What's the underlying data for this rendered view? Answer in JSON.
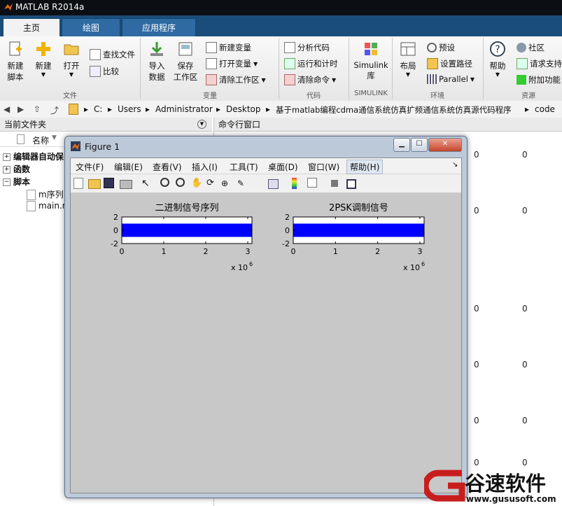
{
  "window": {
    "title": "MATLAB R2014a"
  },
  "tabs": [
    {
      "label": "主页"
    },
    {
      "label": "绘图"
    },
    {
      "label": "应用程序"
    }
  ],
  "ribbon": {
    "file": {
      "new_script": "新建\n脚本",
      "new": "新建",
      "open": "打开",
      "find_files": "查找文件",
      "compare": "比较",
      "group": "文件"
    },
    "variable": {
      "import": "导入\n数据",
      "save_workspace": "保存\n工作区",
      "new_variable": "新建变量",
      "open_variable": "打开变量",
      "clear_workspace": "清除工作区",
      "group": "变量"
    },
    "code": {
      "analyze": "分析代码",
      "run_time": "运行和计时",
      "clear_commands": "清除命令",
      "group": "代码"
    },
    "simulink": {
      "label": "Simulink\n库",
      "group": "SIMULINK"
    },
    "environment": {
      "layout": "布局",
      "preferences": "预设",
      "set_path": "设置路径",
      "parallel": "Parallel",
      "group": "环境"
    },
    "resources": {
      "help": "帮助",
      "community": "社区",
      "request_support": "请求支持",
      "addons": "附加功能",
      "group": "资源"
    }
  },
  "address_bar": {
    "path": [
      "C:",
      "Users",
      "Administrator",
      "Desktop",
      "基于matlab编程cdma通信系统仿真扩频通信系统仿真源代码程序",
      "code"
    ]
  },
  "current_folder": {
    "title": "当前文件夹",
    "column_name": "名称",
    "sort": "▼",
    "items": [
      {
        "label": "编辑器自动保"
      },
      {
        "label": "函数"
      },
      {
        "label": "脚本"
      },
      {
        "label": "m序列"
      },
      {
        "label": "main.m"
      }
    ]
  },
  "command_window": {
    "title": "命令行窗口",
    "values": [
      "0",
      "0",
      "0",
      "0",
      "0",
      "0",
      "0",
      "0",
      "0",
      "0",
      "0",
      "0"
    ]
  },
  "figure": {
    "title": "Figure 1",
    "menu": [
      "文件(F)",
      "编辑(E)",
      "查看(V)",
      "插入(I)",
      "工具(T)",
      "桌面(D)",
      "窗口(W)",
      "帮助(H)"
    ],
    "toolbar_icons": [
      "new-figure-icon",
      "open-icon",
      "save-icon",
      "print-icon",
      "pointer-icon",
      "zoom-in-icon",
      "zoom-out-icon",
      "pan-icon",
      "rotate-icon",
      "data-cursor-icon",
      "brush-icon",
      "link-icon",
      "colorbar-icon",
      "legend-icon",
      "hide-plot-tools-icon",
      "show-plot-tools-icon"
    ],
    "bar_color": "#0000ff"
  },
  "chart_data": [
    {
      "type": "area",
      "title": "二进制信号序列",
      "xlim": [
        0,
        3100000.0
      ],
      "ylim": [
        -2,
        2
      ],
      "xticks": [
        "0",
        "1",
        "2",
        "3"
      ],
      "yticks": [
        "2",
        "0",
        "-2"
      ],
      "exponent": "x 10",
      "exponent_power": "6",
      "fill_range": [
        -1,
        1
      ],
      "color": "#0000ff"
    },
    {
      "type": "area",
      "title": "2PSK调制信号",
      "xlim": [
        0,
        3100000.0
      ],
      "ylim": [
        -2,
        2
      ],
      "xticks": [
        "0",
        "1",
        "2",
        "3"
      ],
      "yticks": [
        "2",
        "0",
        "-2"
      ],
      "exponent": "x 10",
      "exponent_power": "6",
      "fill_range": [
        -1,
        1
      ],
      "color": "#0000ff"
    }
  ],
  "watermark": {
    "brand": "谷速软件",
    "url": "www.gususoft.com"
  }
}
